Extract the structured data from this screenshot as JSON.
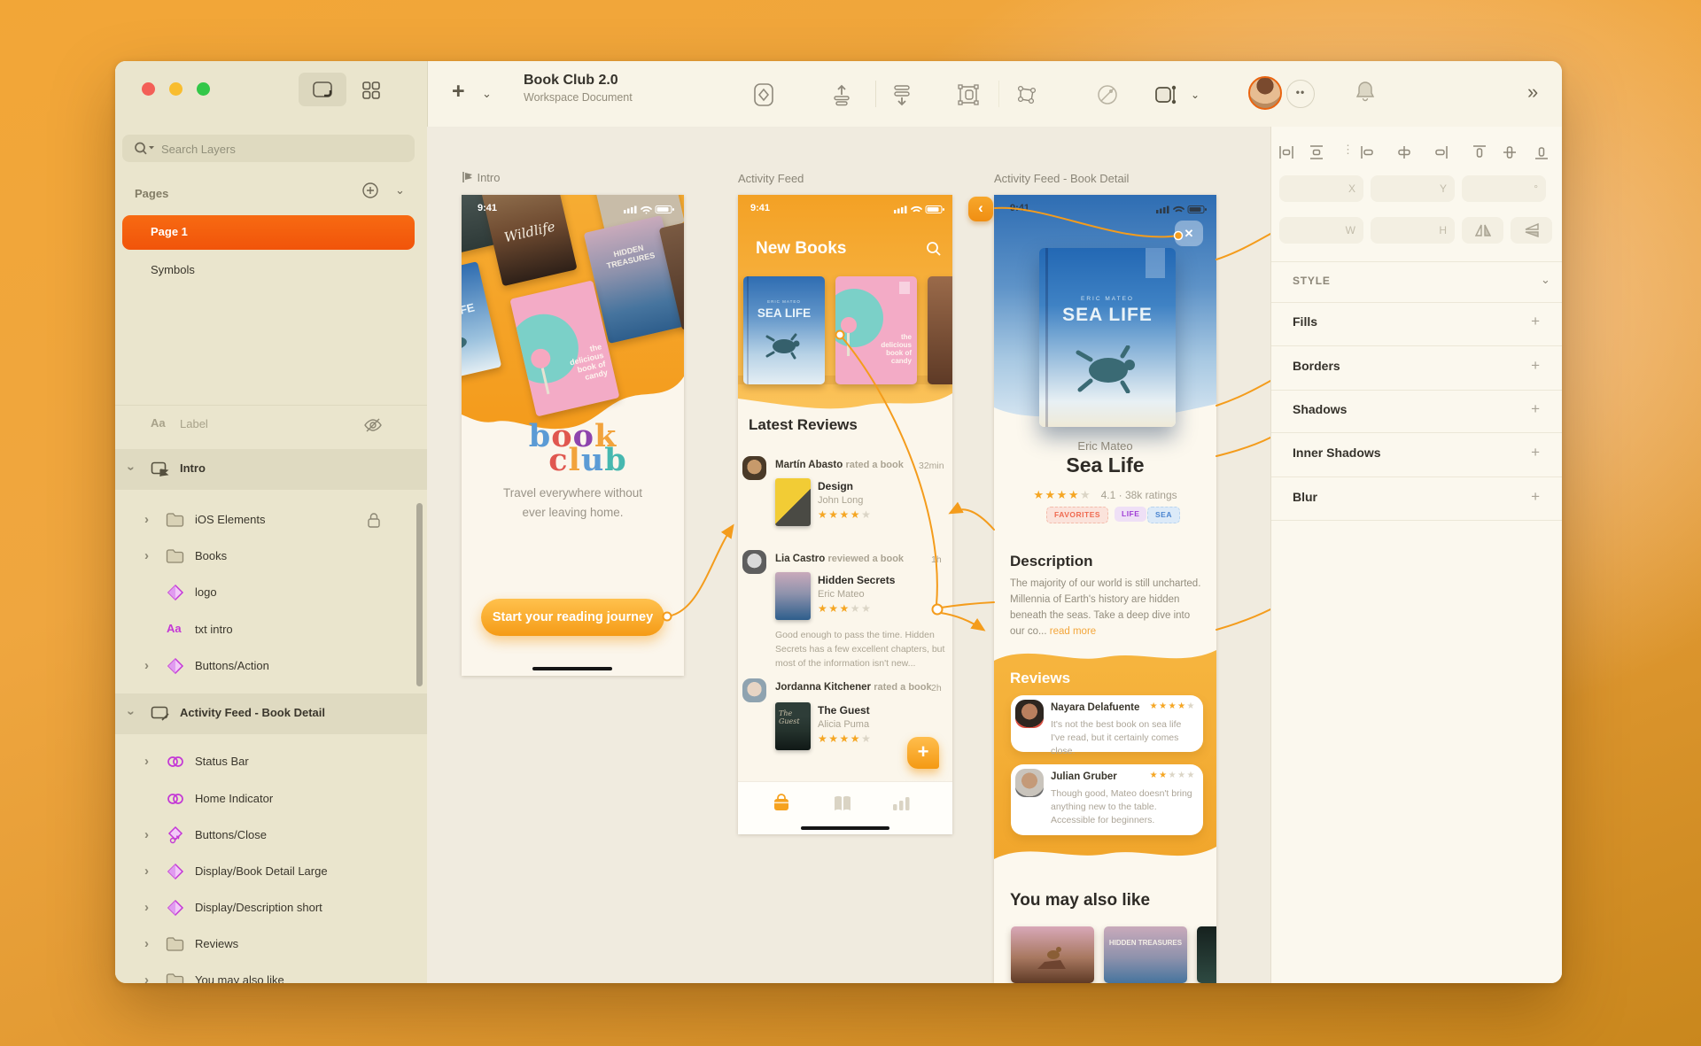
{
  "colors": {
    "accent": "#F49C1C",
    "page_selected": "#F1540A",
    "symbol_magenta": "#C438D6",
    "star_on": "#F5A623"
  },
  "toolbar": {
    "title": "Book Club 2.0",
    "subtitle": "Workspace Document"
  },
  "sidebar": {
    "search_placeholder": "Search Layers",
    "pages_header": "Pages",
    "pages": [
      {
        "label": "Page 1"
      },
      {
        "label": "Symbols"
      }
    ],
    "layers": [
      {
        "label": "Label"
      },
      {
        "label": "Intro"
      },
      {
        "label": "iOS Elements"
      },
      {
        "label": "Books"
      },
      {
        "label": "logo"
      },
      {
        "label": "txt intro"
      },
      {
        "label": "Buttons/Action"
      },
      {
        "label": "Activity Feed - Book Detail"
      },
      {
        "label": "Status Bar"
      },
      {
        "label": "Home Indicator"
      },
      {
        "label": "Buttons/Close"
      },
      {
        "label": "Display/Book Detail Large"
      },
      {
        "label": "Display/Description short"
      },
      {
        "label": "Reviews"
      },
      {
        "label": "You may also like"
      }
    ]
  },
  "canvas": {
    "intro": {
      "label": "Intro",
      "time": "9:41",
      "logo": [
        {
          "ch": "b",
          "color": "#5B9BD5"
        },
        {
          "ch": "o",
          "color": "#E0574F"
        },
        {
          "ch": "o",
          "color": "#8E44AD"
        },
        {
          "ch": "k",
          "color": "#F2A33C"
        },
        {
          "ch": "c",
          "color": "#E0574F"
        },
        {
          "ch": "l",
          "color": "#F2A33C"
        },
        {
          "ch": "u",
          "color": "#5B9BD5"
        },
        {
          "ch": "b",
          "color": "#46B8B0"
        }
      ],
      "tagline_1": "Travel everywhere without",
      "tagline_2": "ever leaving home.",
      "button": "Start your reading journey",
      "covers": {
        "wildlife": "Wildlife",
        "hidden": "HIDDEN TREASURES",
        "candy": "the delicious book of candy",
        "sea": "SEA LIFE"
      }
    },
    "feed": {
      "label": "Activity Feed",
      "time": "9:41",
      "header": "New Books",
      "section": "Latest Reviews",
      "sea_author": "ERIC MATEO",
      "sea_title": "SEA LIFE",
      "candy_title": "the delicious book of candy",
      "reviews": [
        {
          "user": "Martín Abasto",
          "action": "rated a book",
          "when": "32min",
          "title": "Design",
          "author": "John Long",
          "stars": 4
        },
        {
          "user": "Lia Castro",
          "action": "reviewed a book",
          "when": "1h",
          "title": "Hidden Secrets",
          "author": "Eric Mateo",
          "stars": 3,
          "excerpt": "Good enough to pass the time. Hidden Secrets has a few excellent chapters, but most of the information isn't new..."
        },
        {
          "user": "Jordanna Kitchener",
          "action": "rated a book",
          "when": "2h",
          "title": "The Guest",
          "author": "Alicia Puma",
          "stars": 4
        }
      ],
      "fab": "+"
    },
    "detail": {
      "label": "Activity Feed - Book Detail",
      "time": "9:41",
      "close": "✕",
      "back": "‹",
      "cover_author": "ERIC MATEO",
      "cover_title": "SEA LIFE",
      "author": "Eric Mateo",
      "title": "Sea Life",
      "stars": 4,
      "rating": "4.1 · 38k ratings",
      "tags": [
        {
          "label": "FAVORITES",
          "fg": "#EF6A50",
          "bg": "#FBE3DB"
        },
        {
          "label": "LIFE",
          "fg": "#A13FD6",
          "bg": "#EFE0F6"
        },
        {
          "label": "SEA",
          "fg": "#4A84CF",
          "bg": "#DCEAF8"
        }
      ],
      "desc_header": "Description",
      "desc": "The majority of our world is still uncharted. Millennia of Earth's history are hidden beneath the seas. Take a deep dive into our co...",
      "read_more": "read more",
      "reviews_header": "Reviews",
      "reviews": [
        {
          "user": "Nayara Delafuente",
          "stars": 4,
          "text": "It's not the best book on sea life I've read, but it certainly comes close."
        },
        {
          "user": "Julian Gruber",
          "stars": 2,
          "text": "Though good, Mateo doesn't bring anything new to the table. Accessible for beginners."
        }
      ],
      "also_header": "You may also like",
      "also_cover": "HIDDEN TREASURES"
    }
  },
  "inspector": {
    "x": "X",
    "y": "Y",
    "w": "W",
    "h": "H",
    "deg": "°",
    "style_header": "STYLE",
    "sections": [
      {
        "label": "Fills"
      },
      {
        "label": "Borders"
      },
      {
        "label": "Shadows"
      },
      {
        "label": "Inner Shadows"
      },
      {
        "label": "Blur"
      }
    ],
    "plus": "+"
  }
}
